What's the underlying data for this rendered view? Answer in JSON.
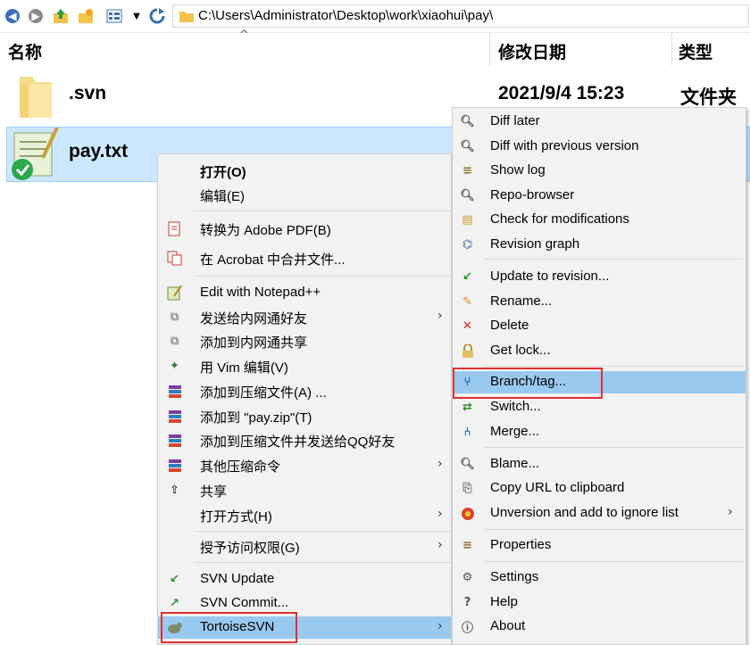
{
  "toolbar": {
    "address": "C:\\Users\\Administrator\\Desktop\\work\\xiaohui\\pay\\",
    "icons": [
      "back-icon",
      "forward-icon",
      "up-folder-icon",
      "new-folder-icon",
      "view-icon",
      "dropdown-icon",
      "refresh-icon"
    ]
  },
  "columns": {
    "name": "名称",
    "modified": "修改日期",
    "type": "类型",
    "sort_indicator": "^"
  },
  "files": [
    {
      "name": ".svn",
      "modified": "2021/9/4 15:23",
      "type": "文件夹"
    },
    {
      "name": "pay.txt"
    }
  ],
  "context_menu": {
    "items": [
      {
        "label": "打开(O)",
        "bold": true
      },
      {
        "label": "编辑(E)"
      },
      {
        "label": "转换为 Adobe PDF(B)",
        "icon": "pdf-icon"
      },
      {
        "label": "在 Acrobat 中合并文件...",
        "icon": "acrobat-combine-icon"
      },
      {
        "label": "Edit with Notepad++",
        "icon": "notepad-icon"
      },
      {
        "label": "发送给内网通好友",
        "icon": "send-icon",
        "submenu": true
      },
      {
        "label": "添加到内网通共享",
        "icon": "share-net-icon"
      },
      {
        "label": "用 Vim 编辑(V)",
        "icon": "vim-icon"
      },
      {
        "label": "添加到压缩文件(A) ...",
        "icon": "winrar-icon"
      },
      {
        "label": "添加到 \"pay.zip\"(T)",
        "icon": "winrar-icon"
      },
      {
        "label": "添加到压缩文件并发送给QQ好友",
        "icon": "winrar-icon"
      },
      {
        "label": "其他压缩命令",
        "icon": "winrar-icon",
        "submenu": true
      },
      {
        "label": "共享",
        "icon": "share-icon"
      },
      {
        "label": "打开方式(H)",
        "submenu": true
      },
      {
        "label": "授予访问权限(G)",
        "submenu": true
      },
      {
        "label": "SVN Update",
        "icon": "svn-update-icon"
      },
      {
        "label": "SVN Commit...",
        "icon": "svn-commit-icon"
      },
      {
        "label": "TortoiseSVN",
        "icon": "tortoise-icon",
        "submenu": true
      }
    ]
  },
  "svn_menu": {
    "items": [
      {
        "label": "Diff later",
        "icon": "diff-icon"
      },
      {
        "label": "Diff with previous version",
        "icon": "diff-icon"
      },
      {
        "label": "Show log",
        "icon": "log-icon"
      },
      {
        "label": "Repo-browser",
        "icon": "repo-icon"
      },
      {
        "label": "Check for modifications",
        "icon": "check-icon"
      },
      {
        "label": "Revision graph",
        "icon": "graph-icon"
      },
      {
        "label": "Update to revision...",
        "icon": "update-icon"
      },
      {
        "label": "Rename...",
        "icon": "rename-icon"
      },
      {
        "label": "Delete",
        "icon": "delete-icon"
      },
      {
        "label": "Get lock...",
        "icon": "lock-icon"
      },
      {
        "label": "Branch/tag...",
        "icon": "branch-icon",
        "highlighted": true
      },
      {
        "label": "Switch...",
        "icon": "switch-icon"
      },
      {
        "label": "Merge...",
        "icon": "merge-icon"
      },
      {
        "label": "Blame...",
        "icon": "blame-icon"
      },
      {
        "label": "Copy URL to clipboard",
        "icon": "copy-icon"
      },
      {
        "label": "Unversion and add to ignore list",
        "icon": "ignore-icon",
        "submenu": true
      },
      {
        "label": "Properties",
        "icon": "properties-icon"
      },
      {
        "label": "Settings",
        "icon": "settings-icon"
      },
      {
        "label": "Help",
        "icon": "help-icon"
      },
      {
        "label": "About",
        "icon": "about-icon"
      }
    ]
  },
  "submenu_arrow": "›",
  "colors": {
    "selection": "#cce8ff",
    "menu_highlight": "#99c9ef",
    "annotation_red": "#e0302f"
  }
}
